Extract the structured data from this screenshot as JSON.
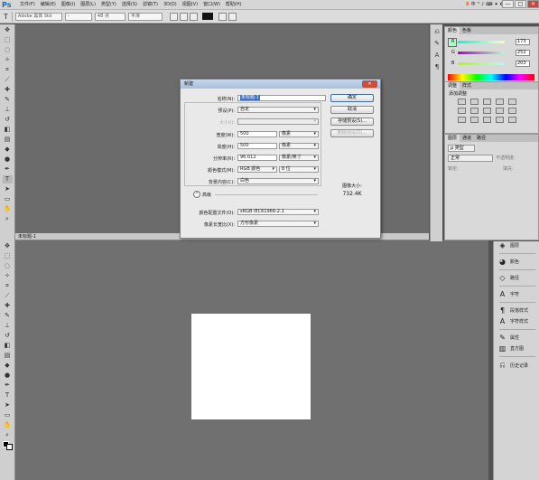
{
  "app": {
    "logo": "Ps"
  },
  "menubar": {
    "items": [
      "文件(F)",
      "编辑(E)",
      "图像(I)",
      "图层(L)",
      "类型(Y)",
      "选择(S)",
      "滤镜(T)",
      "3D(D)",
      "视图(V)",
      "窗口(W)",
      "帮助(H)"
    ],
    "ime": {
      "logo": "S",
      "items": [
        "中",
        "°",
        "♪",
        "⌨",
        "✦",
        "✿"
      ]
    },
    "window_controls": {
      "minimize": "—",
      "maximize": "□",
      "close": "✕"
    }
  },
  "options_bar": {
    "font_family": "Adobe 黑体 Std",
    "font_style": "-",
    "font_size": "48 点",
    "antialias": "平滑"
  },
  "document_tab": {
    "title": "未标题-1"
  },
  "color_panel": {
    "tabs": [
      "颜色",
      "色板"
    ],
    "channels": [
      {
        "label": "R",
        "value": "173"
      },
      {
        "label": "G",
        "value": "252"
      },
      {
        "label": "B",
        "value": "203"
      }
    ],
    "accent": "#adfccb"
  },
  "adjust_panel": {
    "tabs": [
      "调整",
      "样式"
    ],
    "title": "添加调整"
  },
  "layers_panel": {
    "tabs": [
      "图层",
      "通道",
      "路径"
    ],
    "kind_filter": "ρ 类型",
    "blend_mode": "正常",
    "opacity_label": "不透明度:",
    "lock_label": "锁定:",
    "fill_label": "填充:"
  },
  "side_panel": {
    "items": [
      "图层",
      "颜色",
      "路径",
      "字符",
      "段落样式",
      "字符样式",
      "属性",
      "直方图",
      "历史记录"
    ]
  },
  "dialog": {
    "title": "新建",
    "close_label": "✕",
    "name_label": "名称(N):",
    "name_value": "未标题-1",
    "preset_label": "预设(P):",
    "preset_value": "自定",
    "size_label": "大小(I):",
    "width_label": "宽度(W):",
    "width_value": "500",
    "width_unit": "像素",
    "height_label": "高度(H):",
    "height_value": "500",
    "height_unit": "像素",
    "resolution_label": "分辨率(R):",
    "resolution_value": "96.012",
    "resolution_unit": "像素/英寸",
    "color_mode_label": "颜色模式(M):",
    "color_mode_value": "RGB 颜色",
    "bit_depth": "8 位",
    "background_label": "背景内容(C):",
    "background_value": "白色",
    "advanced_label": "高级",
    "profile_label": "颜色配置文件(O):",
    "profile_value": "sRGB IEC61966-2.1",
    "pixel_aspect_label": "像素长宽比(X):",
    "pixel_aspect_value": "方形像素",
    "ok_button": "确定",
    "cancel_button": "取消",
    "save_preset_button": "存储预设(S)...",
    "delete_preset_button": "删除预设(D)...",
    "image_size_label": "图像大小:",
    "image_size_value": "732.4K"
  }
}
